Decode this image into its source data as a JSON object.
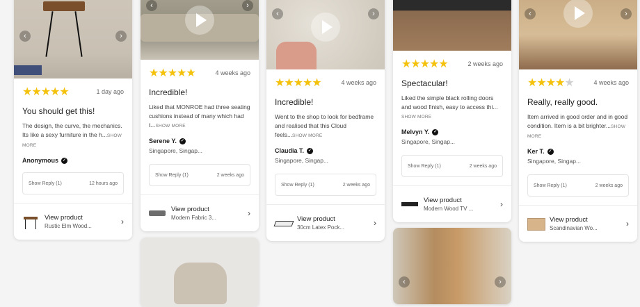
{
  "cards": [
    {
      "stars": "★★★★★",
      "star_empty": "",
      "time": "1 day ago",
      "title": "You should get this!",
      "text": "The design, the curve, the mechanics. Its like a sexy furniture in the h...",
      "more": "SHOW MORE",
      "author": "Anonymous",
      "location": "",
      "reply": "Show Reply (1)",
      "reply_time": "12 hours ago",
      "product_label": "View product",
      "product_name": "Rustic Elm Wood..."
    },
    {
      "stars": "★★★★★",
      "star_empty": "",
      "time": "4 weeks ago",
      "title": "Incredible!",
      "text": "Liked that MONROE had three seating cushions instead of many which had t...",
      "more": "SHOW MORE",
      "author": "Serene Y.",
      "location": "Singapore, Singap...",
      "reply": "Show Reply (1)",
      "reply_time": "2 weeks ago",
      "product_label": "View product",
      "product_name": "Modern Fabric 3..."
    },
    {
      "stars": "★★★★★",
      "star_empty": "",
      "time": "4 weeks ago",
      "title": "Incredible!",
      "text": "Went to the shop to look for bedframe and realised that this Cloud feels...",
      "more": "SHOW MORE",
      "author": "Claudia T.",
      "location": "Singapore, Singap...",
      "reply": "Show Reply (1)",
      "reply_time": "2 weeks ago",
      "product_label": "View product",
      "product_name": "30cm Latex Pock..."
    },
    {
      "stars": "★★★★★",
      "star_empty": "",
      "time": "2 weeks ago",
      "title": "Spectacular!",
      "text": "Liked the simple black rolling doors and wood finish, easy to access thi...",
      "more": "SHOW MORE",
      "author": "Melvyn Y.",
      "location": "Singapore, Singap...",
      "reply": "Show Reply (1)",
      "reply_time": "2 weeks ago",
      "product_label": "View product",
      "product_name": "Modern Wood TV ..."
    },
    {
      "stars": "★★★★",
      "star_empty": "★",
      "time": "4 weeks ago",
      "title": "Really, really good.",
      "text": "Item arrived in good order and in good condition. Item is a bit brighter...",
      "more": "SHOW MORE",
      "author": "Ker T.",
      "location": "Singapore, Singap...",
      "reply": "Show Reply (1)",
      "reply_time": "2 weeks ago",
      "product_label": "View product",
      "product_name": "Scandinavian Wo..."
    }
  ],
  "icons": {
    "prev": "chevron-left-icon",
    "next": "chevron-right-icon",
    "play": "play-icon",
    "verified": "verified-check-icon"
  },
  "colors": {
    "star": "#f4c20d",
    "star_empty": "#d0d0d0"
  }
}
